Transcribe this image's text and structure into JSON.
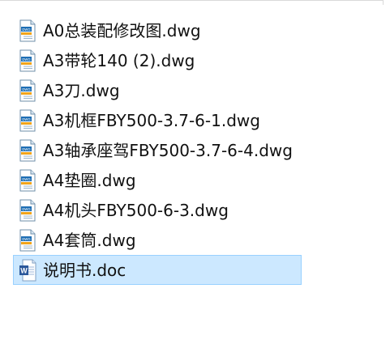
{
  "files": [
    {
      "name": "A0总装配修改图.dwg",
      "type": "dwg",
      "icon": "dwg-file-icon",
      "selected": false
    },
    {
      "name": "A3带轮140 (2).dwg",
      "type": "dwg",
      "icon": "dwg-file-icon",
      "selected": false
    },
    {
      "name": "A3刀.dwg",
      "type": "dwg",
      "icon": "dwg-file-icon",
      "selected": false
    },
    {
      "name": "A3机框FBY500-3.7-6-1.dwg",
      "type": "dwg",
      "icon": "dwg-file-icon",
      "selected": false
    },
    {
      "name": "A3轴承座驾FBY500-3.7-6-4.dwg",
      "type": "dwg",
      "icon": "dwg-file-icon",
      "selected": false
    },
    {
      "name": "A4垫圈.dwg",
      "type": "dwg",
      "icon": "dwg-file-icon",
      "selected": false
    },
    {
      "name": "A4机头FBY500-6-3.dwg",
      "type": "dwg",
      "icon": "dwg-file-icon",
      "selected": false
    },
    {
      "name": "A4套筒.dwg",
      "type": "dwg",
      "icon": "dwg-file-icon",
      "selected": false
    },
    {
      "name": "说明书.doc",
      "type": "doc",
      "icon": "word-document-icon",
      "selected": true
    }
  ],
  "icons": {
    "dwg_label": "DWG",
    "word_label": "W"
  },
  "colors": {
    "selection_fill": "#cce8ff",
    "selection_border": "#99d1ff",
    "dwg_accent": "#1f6fb5",
    "dwg_stripe": "#f2a51a",
    "word_blue": "#2b579a"
  }
}
